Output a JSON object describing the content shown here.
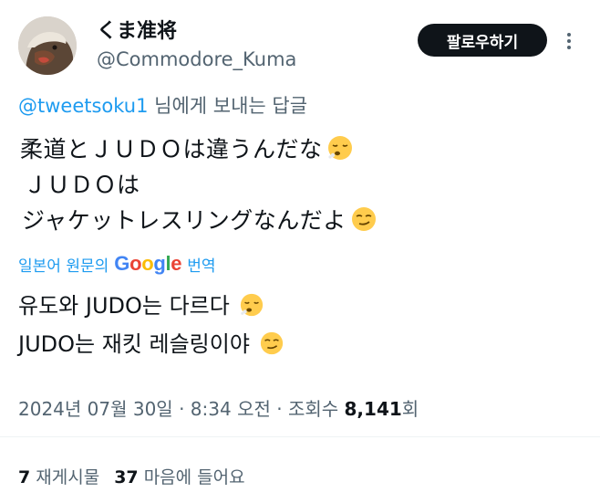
{
  "user": {
    "display_name": "くま准将",
    "handle": "@Commodore_Kuma",
    "follow_label": "팔로우하기"
  },
  "reply": {
    "mention": "@tweetsoku1",
    "suffix": " 님에게 보내는 답글"
  },
  "tweet": {
    "line1": "柔道とＪＵＤＯは違うんだな",
    "line2": "ＪＵＤＯは",
    "line3": "ジャケットレスリングなんだよ"
  },
  "translation": {
    "prefix": "일본어 원문의",
    "brand": "Google",
    "suffix": "번역",
    "line1": "유도와 JUDO는 다르다",
    "line2": "JUDO는 재킷 레슬링이야"
  },
  "meta": {
    "date": "2024년 07월 30일",
    "sep1": " · ",
    "time": "8:34 오전",
    "sep2": " · ",
    "views_label": "조회수 ",
    "views_count": "8,141",
    "views_suffix": "회"
  },
  "stats": {
    "retweets_count": "7",
    "retweets_label": " 재게시물",
    "likes_count": "37",
    "likes_label": " 마음에 들어요"
  },
  "emoji": {
    "sigh": "face-exhaling-emoji",
    "smirk": "smirking-face-emoji"
  }
}
